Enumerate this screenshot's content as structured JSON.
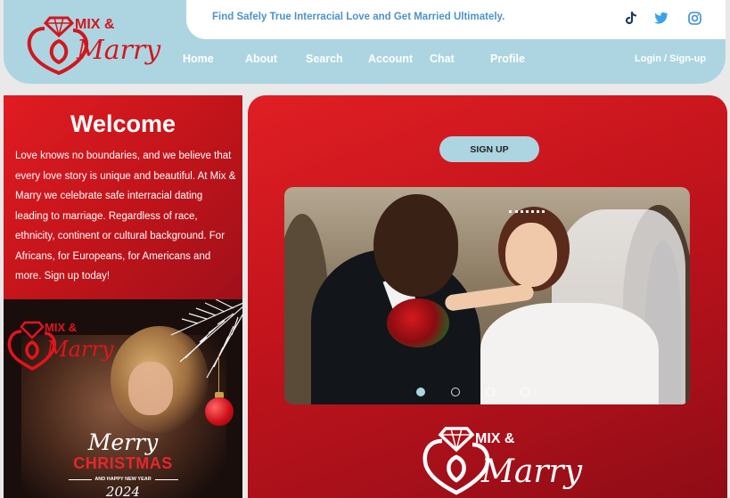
{
  "header": {
    "tagline": "Find Safely True Interracial Love and Get Married Ultimately.",
    "logo": {
      "text_top": "MIX &",
      "text_script": "Marry"
    },
    "social": [
      {
        "name": "tiktok-icon",
        "glyph": "♪"
      },
      {
        "name": "twitter-icon",
        "glyph": ""
      },
      {
        "name": "instagram-icon",
        "glyph": ""
      }
    ],
    "nav": [
      {
        "label": "Home"
      },
      {
        "label": "About"
      },
      {
        "label": "Search"
      },
      {
        "label": "Account"
      },
      {
        "label": "Chat"
      },
      {
        "label": "Profile"
      }
    ],
    "login_label": "Login / Sign-up"
  },
  "welcome": {
    "title": "Welcome",
    "text": "Love knows no boundaries, and we believe that every love story is unique and beautiful. At Mix & Marry we celebrate safe interracial dating leading to marriage. Regardless of race, ethnicity, continent or cultural background. For Africans, for Europeans, for Americans and more. Sign up today!"
  },
  "promo": {
    "logo_top": "MIX &",
    "logo_script": "Marry",
    "merry": "Merry",
    "christmas": "CHRISTMAS",
    "new_year": "AND HAPPY NEW YEAR",
    "year": "2024"
  },
  "main": {
    "signup_label": "SIGN UP",
    "slider": {
      "total": 4,
      "active": 1
    },
    "footer_logo": {
      "text_top": "MIX &",
      "text_script": "Marry"
    }
  },
  "colors": {
    "brand_red": "#d3161e",
    "accent_blue": "#acd5e1",
    "tagline_blue": "#4d93c7"
  }
}
